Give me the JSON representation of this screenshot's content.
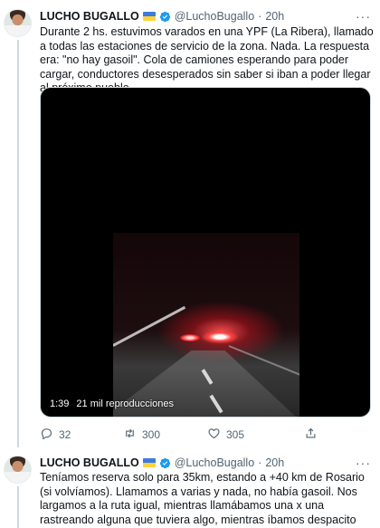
{
  "tweets": [
    {
      "author": "LUCHO BUGALLO",
      "handle": "@LuchoBugallo",
      "separator": "·",
      "time": "20h",
      "text": "Durante 2 hs. estuvimos varados en una YPF (La Ribera), llamado a todas las estaciones de servicio de la zona. Nada. La respuesta era: \"no hay gasoil\". Cola de camiones esperando para poder cargar, conductores desesperados sin saber si iban a poder llegar al próximo pueblo.",
      "video": {
        "duration": "1:39",
        "views": "21 mil reproducciones"
      },
      "stats": {
        "replies": "32",
        "retweets": "300",
        "likes": "305"
      }
    },
    {
      "author": "LUCHO BUGALLO",
      "handle": "@LuchoBugallo",
      "separator": "·",
      "time": "20h",
      "text": "Teníamos reserva solo para 35km, estando a +40 km de Rosario (si volvíamos). Llamamos a varias y nada, no había gasoil. Nos largamos a la ruta igual, mientras llamábamos una x una rastreando alguna que tuviera algo, mientras íbamos despacito para evitar quedarnos a pata."
    }
  ],
  "more_label": "···",
  "colors": {
    "verified": "#1d9bf0",
    "secondary_text": "#536471",
    "thread_line": "#cfd9de"
  },
  "icons": [
    "reply-icon",
    "retweet-icon",
    "like-icon",
    "share-icon",
    "verified-badge-icon",
    "flag-icon"
  ]
}
